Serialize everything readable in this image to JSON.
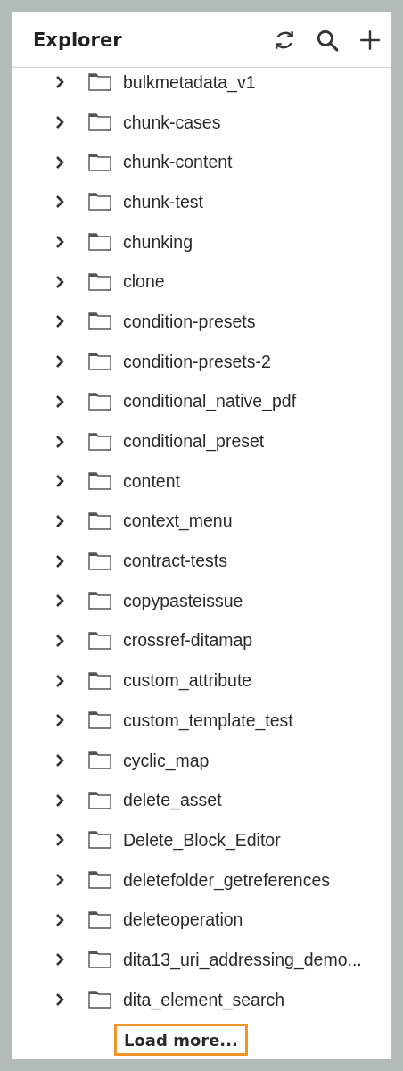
{
  "panel": {
    "title": "Explorer"
  },
  "toolbar": [
    {
      "kind": "refresh"
    },
    {
      "kind": "search"
    },
    {
      "kind": "add"
    }
  ],
  "folders": [
    {
      "name": "bulkmetadata_v1",
      "expanded": false
    },
    {
      "name": "chunk-cases",
      "expanded": false
    },
    {
      "name": "chunk-content",
      "expanded": false
    },
    {
      "name": "chunk-test",
      "expanded": false
    },
    {
      "name": "chunking",
      "expanded": false
    },
    {
      "name": "clone",
      "expanded": false
    },
    {
      "name": "condition-presets",
      "expanded": false
    },
    {
      "name": "condition-presets-2",
      "expanded": false
    },
    {
      "name": "conditional_native_pdf",
      "expanded": false
    },
    {
      "name": "conditional_preset",
      "expanded": false
    },
    {
      "name": "content",
      "expanded": false
    },
    {
      "name": "context_menu",
      "expanded": false
    },
    {
      "name": "contract-tests",
      "expanded": false
    },
    {
      "name": "copypasteissue",
      "expanded": false
    },
    {
      "name": "crossref-ditamap",
      "expanded": false
    },
    {
      "name": "custom_attribute",
      "expanded": false
    },
    {
      "name": "custom_template_test",
      "expanded": false
    },
    {
      "name": "cyclic_map",
      "expanded": false
    },
    {
      "name": "delete_asset",
      "expanded": false
    },
    {
      "name": "Delete_Block_Editor",
      "expanded": false
    },
    {
      "name": "deletefolder_getreferences",
      "expanded": false
    },
    {
      "name": "deleteoperation",
      "expanded": false
    },
    {
      "name": "dita13_uri_addressing_demo...",
      "expanded": false
    },
    {
      "name": "dita_element_search",
      "expanded": false
    }
  ],
  "load_more": {
    "label": "Load more...",
    "focused": true
  }
}
